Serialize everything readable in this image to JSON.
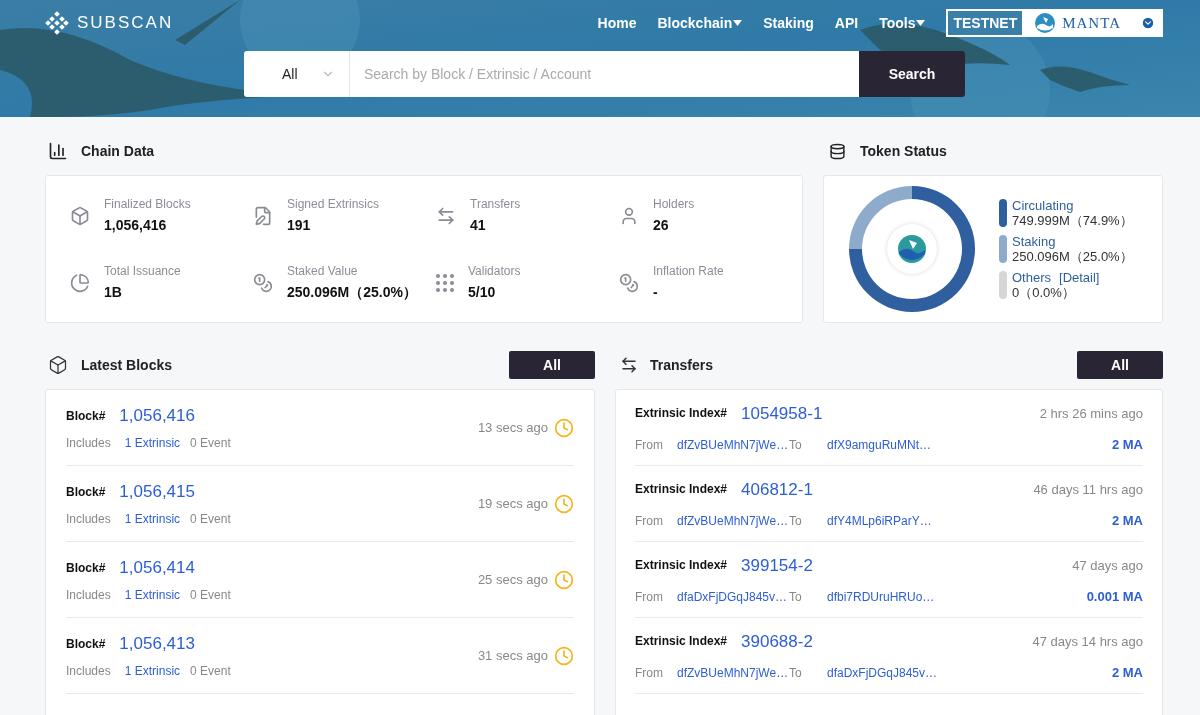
{
  "header": {
    "logo": "SUBSCAN",
    "nav": [
      {
        "label": "Home",
        "has_menu": false
      },
      {
        "label": "Blockchain",
        "has_menu": true
      },
      {
        "label": "Staking",
        "has_menu": false
      },
      {
        "label": "API",
        "has_menu": false
      },
      {
        "label": "Tools",
        "has_menu": true
      }
    ],
    "network_badge": "TESTNET",
    "network_name": "MANTA"
  },
  "search": {
    "filter": "All",
    "placeholder": "Search by Block / Extrinsic / Account",
    "button": "Search"
  },
  "chain_data": {
    "title": "Chain Data",
    "stats": [
      {
        "label": "Finalized Blocks",
        "value": "1,056,416"
      },
      {
        "label": "Signed Extrinsics",
        "value": "191"
      },
      {
        "label": "Transfers",
        "value": "41"
      },
      {
        "label": "Holders",
        "value": "26"
      },
      {
        "label": "Total Issuance",
        "value": "1B"
      },
      {
        "label": "Staked Value",
        "value": "250.096M（25.0%）"
      },
      {
        "label": "Validators",
        "value": "5/10"
      },
      {
        "label": "Inflation Rate",
        "value": "-"
      }
    ]
  },
  "token_status": {
    "title": "Token Status",
    "chart_data": {
      "type": "donut",
      "categories": [
        "Circulating",
        "Staking",
        "Others"
      ],
      "values": [
        74.9,
        25.0,
        0.0
      ]
    },
    "legend": [
      {
        "value": "749.999M（74.9%）",
        "color": "#2f5f9e"
      },
      {
        "value": "250.096M（25.0%）",
        "color": "#8eabcc"
      },
      {
        "link": "[Detail]",
        "value": "0（0.0%）",
        "color": "#d6d6d6"
      }
    ]
  },
  "latest_blocks": {
    "title": "Latest Blocks",
    "button": "All",
    "rows": [
      {
        "label": "Block#",
        "number": "1,056,416",
        "includes": "Includes",
        "extrinsics": "1 Extrinsic",
        "events": "0 Event",
        "time": "13 secs ago"
      },
      {
        "label": "Block#",
        "number": "1,056,415",
        "includes": "Includes",
        "extrinsics": "1 Extrinsic",
        "events": "0 Event",
        "time": "19 secs ago"
      },
      {
        "label": "Block#",
        "number": "1,056,414",
        "includes": "Includes",
        "extrinsics": "1 Extrinsic",
        "events": "0 Event",
        "time": "25 secs ago"
      },
      {
        "label": "Block#",
        "number": "1,056,413",
        "includes": "Includes",
        "extrinsics": "1 Extrinsic",
        "events": "0 Event",
        "time": "31 secs ago"
      }
    ]
  },
  "transfers": {
    "title": "Transfers",
    "button": "All",
    "rows": [
      {
        "label": "Extrinsic Index#",
        "index": "1054958-1",
        "time": "2 hrs 26 mins ago",
        "from_label": "From",
        "from": "dfZvBUeMhN7jWe…",
        "to_label": "To",
        "to": "dfX9amguRuMNt…",
        "amount": "2 MA"
      },
      {
        "label": "Extrinsic Index#",
        "index": "406812-1",
        "time": "46 days 11 hrs ago",
        "from_label": "From",
        "from": "dfZvBUeMhN7jWe…",
        "to_label": "To",
        "to": "dfY4MLp6iRParY…",
        "amount": "2 MA"
      },
      {
        "label": "Extrinsic Index#",
        "index": "399154-2",
        "time": "47 days ago",
        "from_label": "From",
        "from": "dfaDxFjDGqJ845v…",
        "to_label": "To",
        "to": "dfbi7RDUruHRUo…",
        "amount": "0.001 MA"
      },
      {
        "label": "Extrinsic Index#",
        "index": "390688-2",
        "time": "47 days 14 hrs ago",
        "from_label": "From",
        "from": "dfZvBUeMhN7jWe…",
        "to_label": "To",
        "to": "dfaDxFjDGqJ845v…",
        "amount": "2 MA"
      }
    ]
  }
}
